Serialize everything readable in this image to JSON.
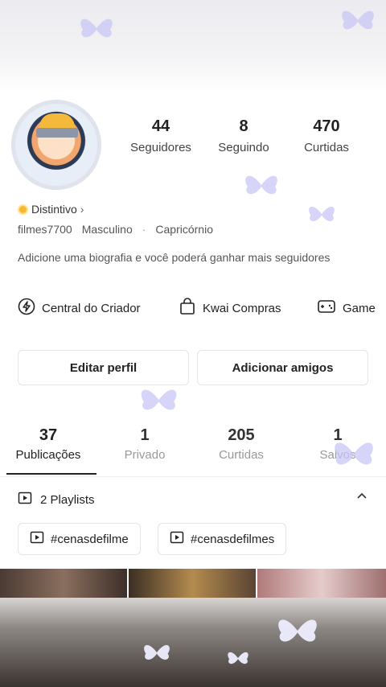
{
  "profile": {
    "badge": "Distintivo",
    "username": "filmes7700",
    "gender": "Masculino",
    "sign": "Capricórnio",
    "bio": "Adicione uma biografia e você poderá ganhar mais seguidores"
  },
  "stats": [
    {
      "value": "44",
      "label": "Seguidores"
    },
    {
      "value": "8",
      "label": "Seguindo"
    },
    {
      "value": "470",
      "label": "Curtidas"
    }
  ],
  "links": [
    {
      "label": "Central do Criador",
      "icon": "lightning-icon"
    },
    {
      "label": "Kwai Compras",
      "icon": "shopping-bag-icon"
    },
    {
      "label": "Game",
      "icon": "gamepad-icon"
    }
  ],
  "buttons": {
    "edit": "Editar perfil",
    "add_friends": "Adicionar amigos"
  },
  "tabs": [
    {
      "value": "37",
      "label": "Publicações"
    },
    {
      "value": "1",
      "label": "Privado"
    },
    {
      "value": "205",
      "label": "Curtidas"
    },
    {
      "value": "1",
      "label": "Salvos"
    }
  ],
  "playlists": {
    "label": "2 Playlists",
    "items": [
      "#cenasdefilme",
      "#cenasdefilmes"
    ]
  },
  "colors": {
    "butterfly": "#b9b6f0",
    "badge": "#f7b731"
  }
}
